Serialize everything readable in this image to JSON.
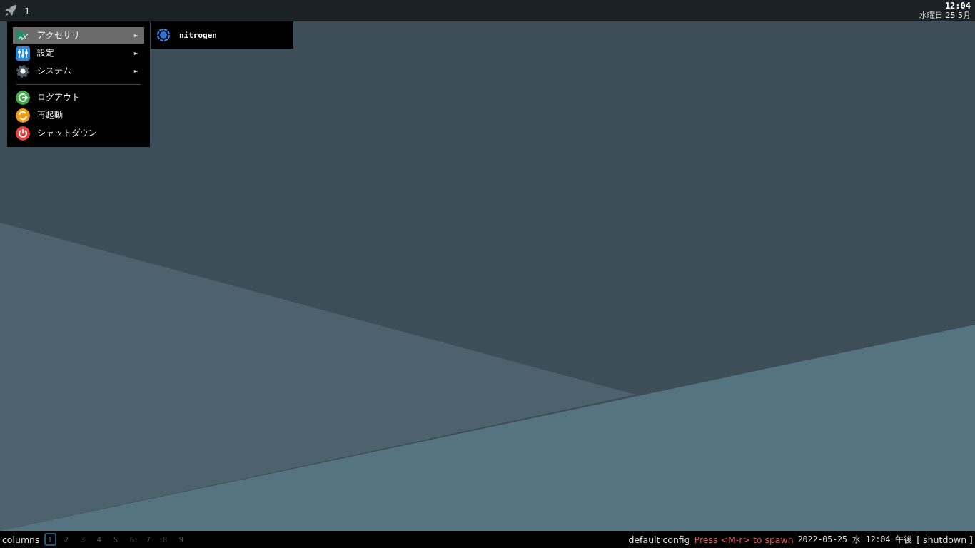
{
  "top_bar": {
    "workspace": "1",
    "clock": {
      "time": "12:04",
      "date": "水曜日 25 5月"
    }
  },
  "menu": {
    "sections": [
      [
        {
          "label": "アクセサリ",
          "arrow": "►",
          "selected": true
        },
        {
          "label": "設定",
          "arrow": "►",
          "selected": false
        },
        {
          "label": "システム",
          "arrow": "►",
          "selected": false
        }
      ],
      [
        {
          "label": "ログアウト",
          "selected": false
        },
        {
          "label": "再起動",
          "selected": false
        },
        {
          "label": "シャットダウン",
          "selected": false
        }
      ]
    ]
  },
  "submenu": {
    "items": [
      {
        "label": "nitrogen"
      }
    ]
  },
  "bottom_bar": {
    "layout": "columns",
    "workspaces": [
      {
        "label": "1",
        "selected": true
      },
      {
        "label": "2",
        "selected": false
      },
      {
        "label": "3",
        "selected": false
      },
      {
        "label": "4",
        "selected": false
      },
      {
        "label": "5",
        "selected": false
      },
      {
        "label": "6",
        "selected": false
      },
      {
        "label": "7",
        "selected": false
      },
      {
        "label": "8",
        "selected": false
      },
      {
        "label": "9",
        "selected": false
      }
    ],
    "config": "default config",
    "hint": "Press <M-r> to spawn",
    "datetime": "2022-05-25 水 12:04 午後",
    "shutdown": "[ shutdown ]"
  }
}
